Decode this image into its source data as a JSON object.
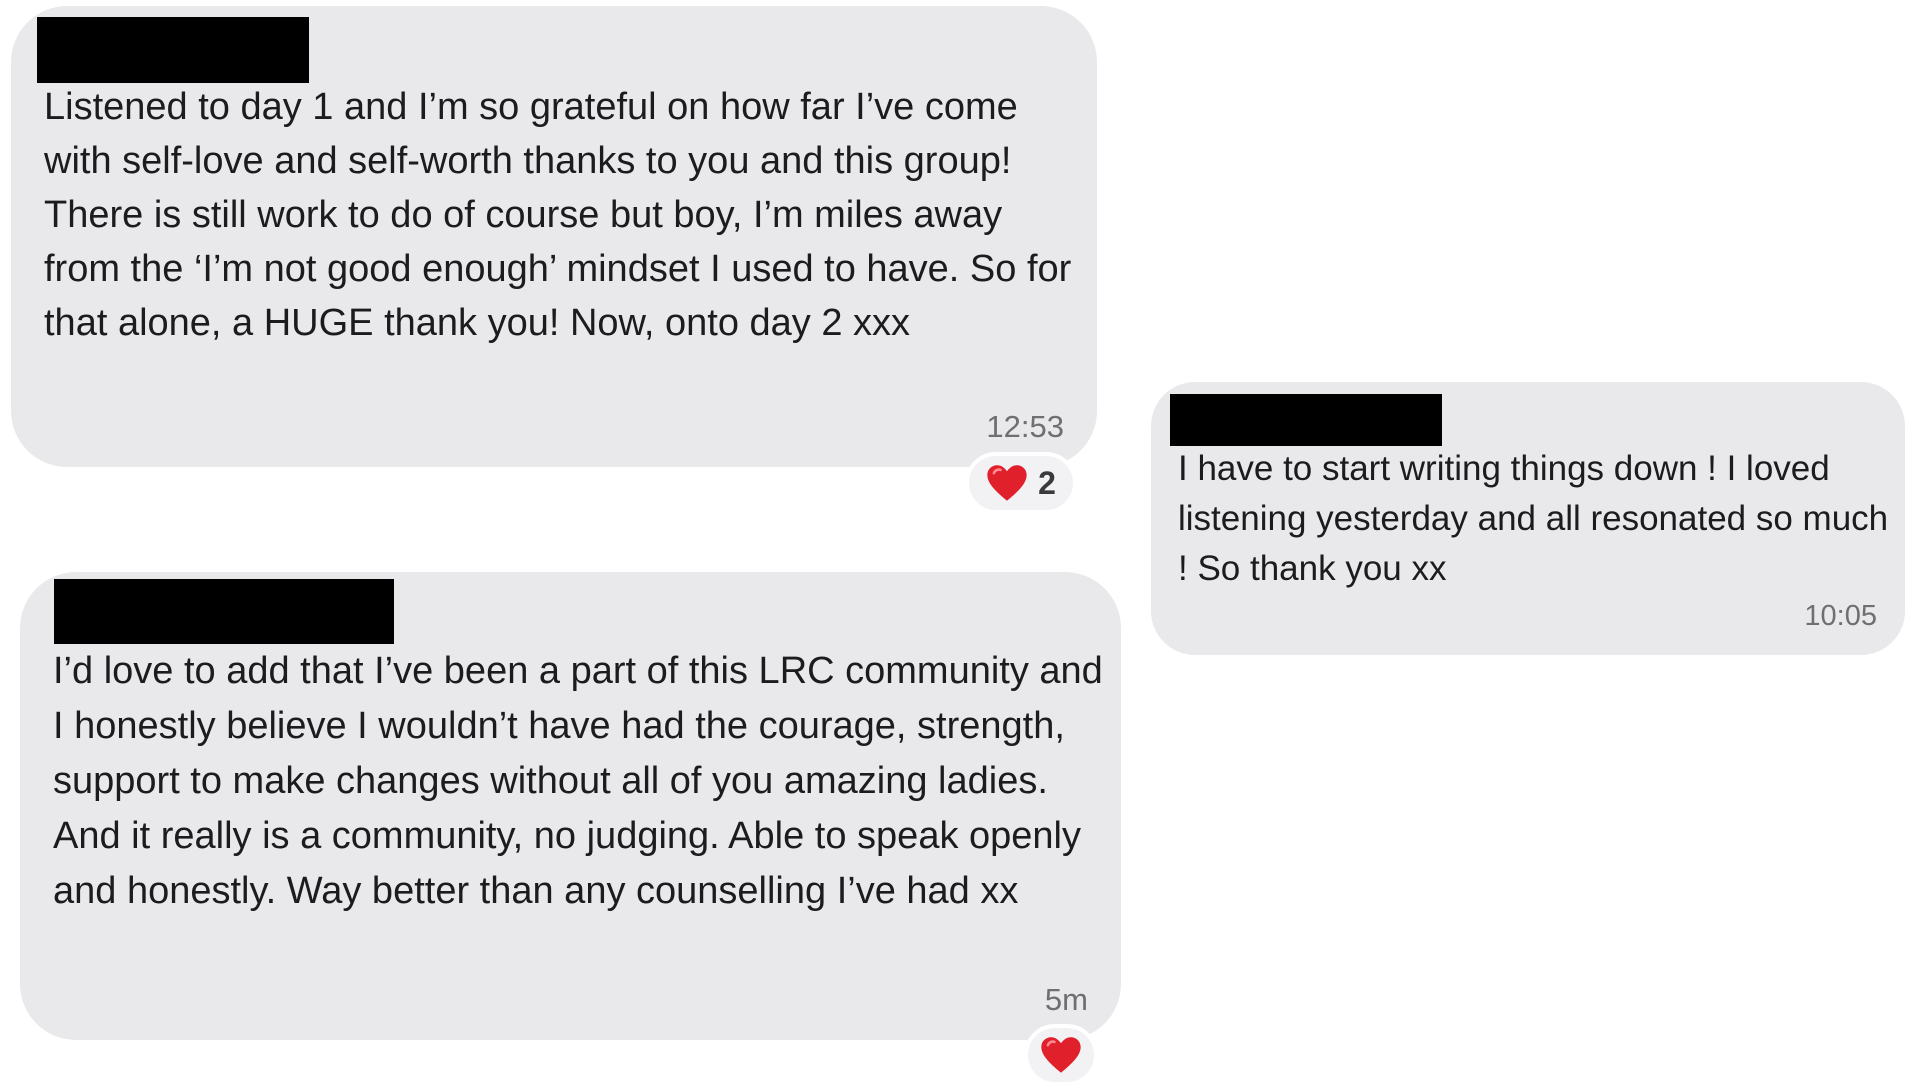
{
  "messages": [
    {
      "text": "Listened to day 1 and I’m so grateful on how far I’ve come with self-love and self-worth thanks to you and this group! There is still work to do of course but boy, I’m miles away from the ‘I’m not good enough’ mindset I used to have. So for that alone, a HUGE thank you! Now, onto day 2 xxx",
      "time": "12:53",
      "reaction": {
        "icon": "heart-icon",
        "count": "2"
      }
    },
    {
      "text": "I have to start writing things down ! I loved listening yesterday and all resonated so much ! So thank you xx",
      "time": "10:05"
    },
    {
      "text": "I’d love to add that I’ve been a part of this LRC community and I honestly believe I wouldn’t have had the courage, strength, support to make changes without all of you amazing ladies. And it really is a community, no judging. Able to speak openly and honestly. Way better than any counselling I’ve had xx",
      "time": "5m",
      "reaction": {
        "icon": "heart-icon"
      }
    }
  ],
  "colors": {
    "bubble": "#e9e9eb",
    "heart": "#e0202a",
    "timestamp": "#6e6e73"
  }
}
